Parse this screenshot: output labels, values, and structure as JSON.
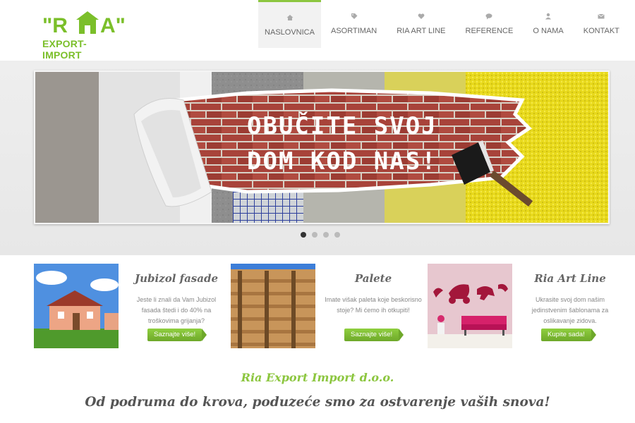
{
  "brand": {
    "logo_letters": "\"R A\"",
    "logo_subtitle": "EXPORT-IMPORT",
    "accent": "#8cc63f"
  },
  "nav": {
    "items": [
      {
        "label": "NASLOVNICA",
        "icon": "home-icon",
        "active": true
      },
      {
        "label": "ASORTIMAN",
        "icon": "tag-icon"
      },
      {
        "label": "RIA ART LINE",
        "icon": "heart-icon"
      },
      {
        "label": "REFERENCE",
        "icon": "comments-icon"
      },
      {
        "label": "O NAMA",
        "icon": "user-icon"
      },
      {
        "label": "KONTAKT",
        "icon": "envelope-icon"
      }
    ]
  },
  "slider": {
    "headline_line1": "OBUČITE SVOJ",
    "headline_line2": "DOM KOD NAS!",
    "slide_count": 4,
    "active_slide": 1
  },
  "features": [
    {
      "title": "Jubizol fasade",
      "description": "Jeste li znali da Vam Jubizol fasada štedi i do 40% na troškovima grijanja?",
      "button": "Saznajte više!"
    },
    {
      "title": "Palete",
      "description": "Imate višak paleta koje beskorisno stoje? Mi ćemo ih otkupiti!",
      "button": "Saznajte više!"
    },
    {
      "title": "Ria Art Line",
      "description": "Ukrasite svoj dom našim jedinstvenim šablonama za oslikavanje zidova.",
      "button": "Kupite sada!"
    }
  ],
  "footer": {
    "company": "Ria Export Import d.o.o.",
    "tagline": "Od podruma do krova, poduzeće smo za ostvarenje vaših snova!"
  }
}
